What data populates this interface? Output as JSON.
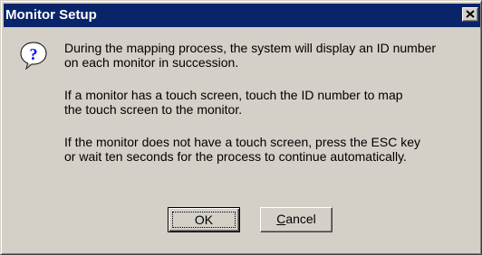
{
  "window": {
    "title": "Monitor Setup",
    "close_symbol": "×"
  },
  "icon": {
    "name": "question-icon",
    "glyph": "?"
  },
  "message": {
    "paragraph1": "During the mapping process, the system will display an ID number\non each monitor in succession.",
    "paragraph2": "If a monitor has a touch screen, touch the ID number to map\nthe touch screen to the monitor.",
    "paragraph3": "If the monitor does not have a touch screen, press the ESC key\nor wait ten seconds for the process to continue automatically."
  },
  "buttons": {
    "ok_label": "OK",
    "cancel_accel": "C",
    "cancel_rest": "ancel"
  },
  "colors": {
    "titlebar": "#0a246a",
    "face": "#d4d0c8",
    "icon_blue": "#0000ff"
  }
}
